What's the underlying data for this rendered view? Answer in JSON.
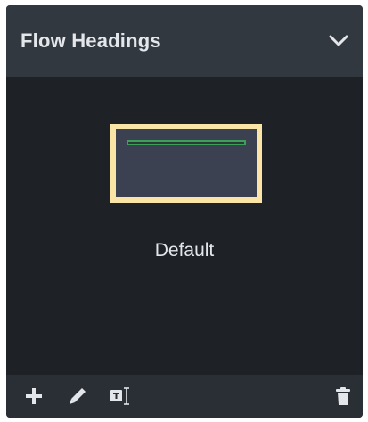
{
  "panel": {
    "title": "Flow Headings",
    "collapse_icon": "chevron-down-icon"
  },
  "styles": [
    {
      "label": "Default",
      "selected": true
    }
  ],
  "toolbar": {
    "buttons": [
      {
        "icon": "plus-icon"
      },
      {
        "icon": "pencil-icon"
      },
      {
        "icon": "text-frame-icon"
      },
      {
        "icon": "trash-icon"
      }
    ]
  },
  "colors": {
    "panel_background": "#1e2226",
    "header_background": "#32383f",
    "selection_border": "#fbe5a6",
    "thumbnail_fill": "#3b4150",
    "heading_line": "#3c9f5a",
    "text": "#e3e6ea"
  }
}
